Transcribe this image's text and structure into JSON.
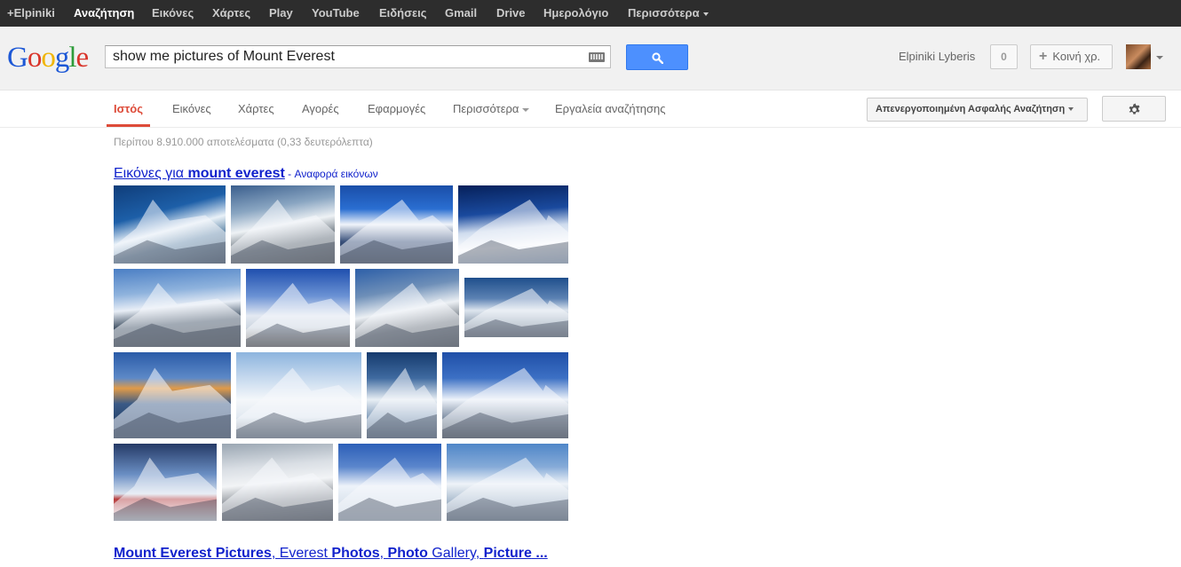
{
  "topbar": {
    "items": [
      {
        "label": "+Elpiniki",
        "active": false
      },
      {
        "label": "Αναζήτηση",
        "active": true
      },
      {
        "label": "Εικόνες",
        "active": false
      },
      {
        "label": "Χάρτες",
        "active": false
      },
      {
        "label": "Play",
        "active": false
      },
      {
        "label": "YouTube",
        "active": false
      },
      {
        "label": "Ειδήσεις",
        "active": false
      },
      {
        "label": "Gmail",
        "active": false
      },
      {
        "label": "Drive",
        "active": false
      },
      {
        "label": "Ημερολόγιο",
        "active": false
      },
      {
        "label": "Περισσότερα",
        "active": false
      }
    ]
  },
  "header": {
    "logo_letters": [
      "G",
      "o",
      "o",
      "g",
      "l",
      "e"
    ],
    "logo_colors": [
      "#1d58d6",
      "#d9362c",
      "#f0b500",
      "#1d58d6",
      "#2e9c3a",
      "#d9362c"
    ],
    "search_value": "show me pictures of Mount Everest",
    "username": "Elpiniki Lyberis",
    "notifications": "0",
    "share_label": "Κοινή χρ."
  },
  "nav": {
    "tabs": [
      {
        "label": "Ιστός",
        "active": true,
        "has_caret": false
      },
      {
        "label": "Εικόνες",
        "active": false,
        "has_caret": false
      },
      {
        "label": "Χάρτες",
        "active": false,
        "has_caret": false
      },
      {
        "label": "Αγορές",
        "active": false,
        "has_caret": false
      },
      {
        "label": "Εφαρμογές",
        "active": false,
        "has_caret": false
      },
      {
        "label": "Περισσότερα",
        "active": false,
        "has_caret": true
      },
      {
        "label": "Εργαλεία αναζήτησης",
        "active": false,
        "has_caret": false
      }
    ],
    "safe_search_label": "Απενεργοποιημένη Ασφαλής Αναζήτηση"
  },
  "results": {
    "stats": "Περίπου 8.910.000 αποτελέσματα (0,33 δευτερόλεπτα)",
    "images_heading_prefix": "Εικόνες για ",
    "images_heading_query": "mount everest",
    "images_heading_separator": " - ",
    "images_report_link": "Αναφορά εικόνων",
    "first_result_title": [
      {
        "text": "Mount Everest Pictures",
        "bold": true
      },
      {
        "text": ", Everest ",
        "bold": false
      },
      {
        "text": "Photos",
        "bold": true
      },
      {
        "text": ", ",
        "bold": false
      },
      {
        "text": "Photo",
        "bold": true
      },
      {
        "text": " Gallery, ",
        "bold": false
      },
      {
        "text": "Picture",
        "bold": true
      },
      {
        "text": " ...",
        "bold": true
      }
    ]
  },
  "accent_colors": {
    "link": "#1122cc",
    "active_tab": "#dd4b39",
    "search_button": "#4d90fe"
  }
}
